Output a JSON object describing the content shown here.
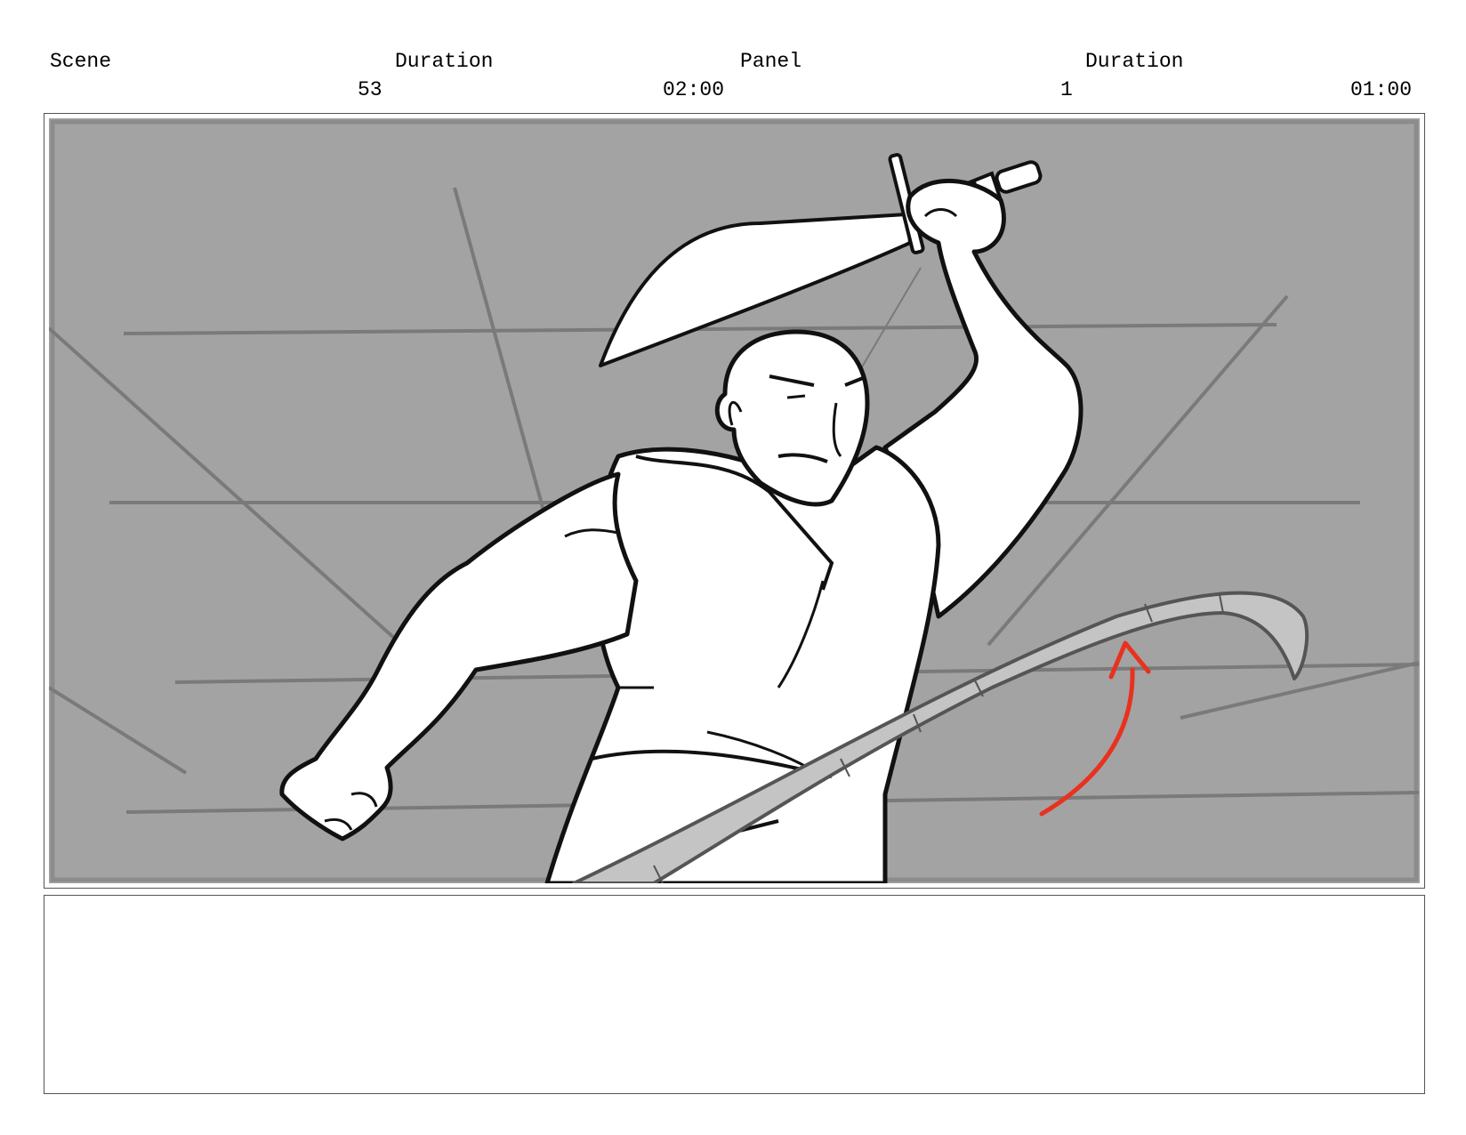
{
  "header": {
    "scene_label": "Scene",
    "scene_value": "53",
    "scene_duration_label": "Duration",
    "scene_duration_value": "02:00",
    "panel_label": "Panel",
    "panel_value": "1",
    "panel_duration_label": "Duration",
    "panel_duration_value": "01:00"
  },
  "panel": {
    "background_color": "#a3a3a3",
    "line_color": "#7a7a7a",
    "figure_fill": "#ffffff",
    "whip_fill": "#c4c4c4",
    "motion_arrow_color": "#e8321e"
  },
  "notes": {
    "text": ""
  }
}
